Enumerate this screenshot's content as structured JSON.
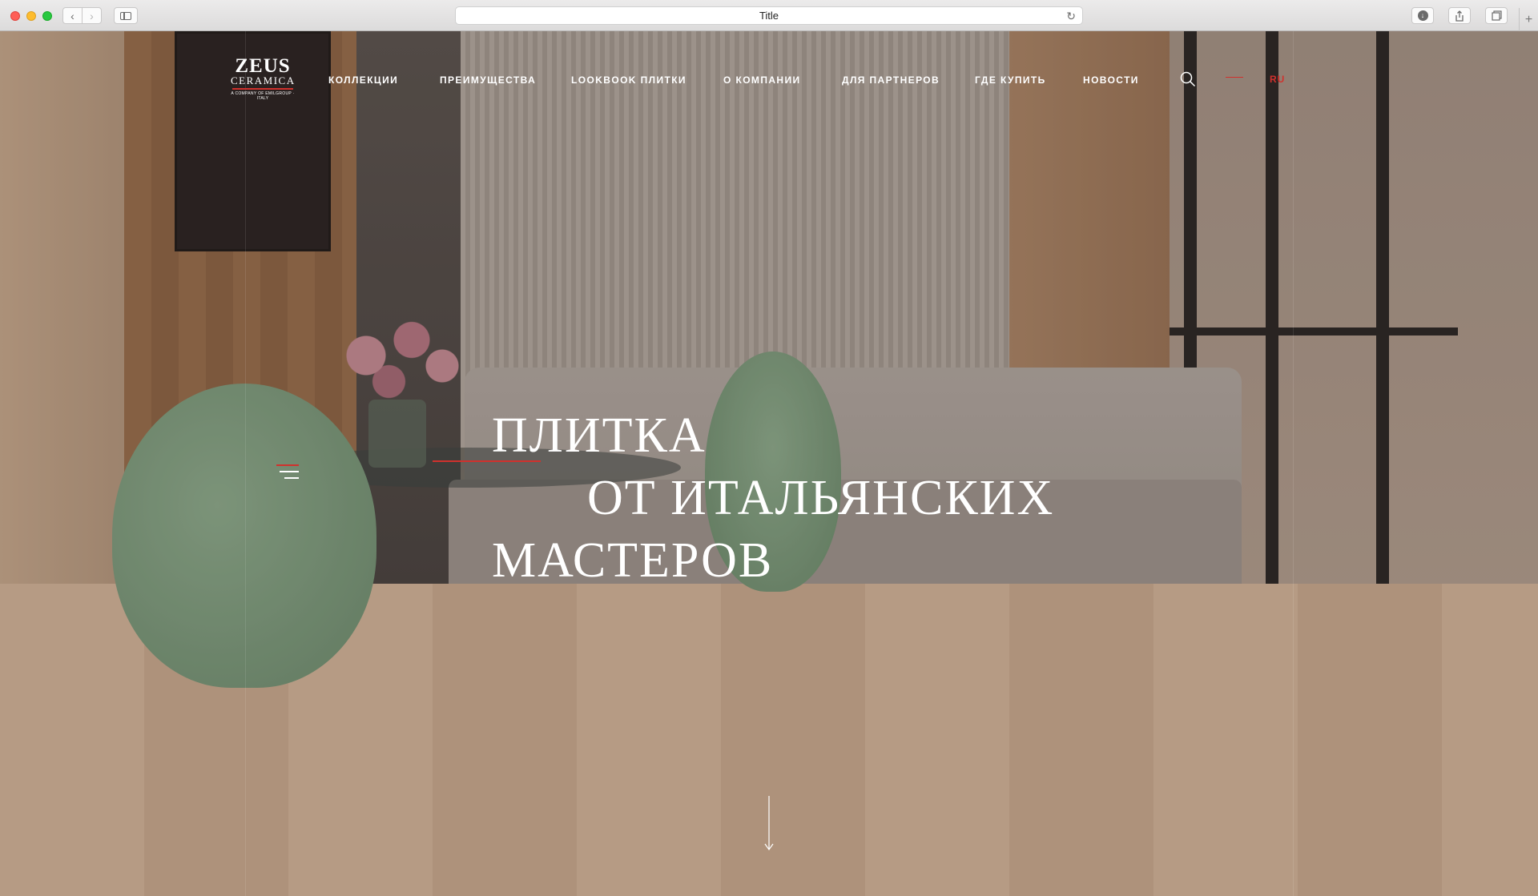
{
  "browser": {
    "tab_title": "Title",
    "back_icon": "chevron-left-icon",
    "forward_icon": "chevron-right-icon",
    "reload_icon": "reload-icon",
    "download_icon": "download-icon",
    "share_icon": "share-icon",
    "tabs_icon": "tabs-overview-icon",
    "new_tab_label": "+"
  },
  "logo": {
    "main": "ZEUS",
    "sub": "CERAMICA",
    "tagline": "A COMPANY OF EMILGROUP · ITALY",
    "accent_color": "#d0312d"
  },
  "nav": {
    "items": [
      {
        "label": "КОЛЛЕКЦИИ"
      },
      {
        "label": "ПРЕИМУЩЕСТВА"
      },
      {
        "label": "LOOKBOOK ПЛИТКИ"
      },
      {
        "label": "О КОМПАНИИ"
      },
      {
        "label": "ДЛЯ ПАРТНЕРОВ"
      },
      {
        "label": "ГДЕ КУПИТЬ"
      },
      {
        "label": "НОВОСТИ"
      }
    ],
    "search_icon": "search-icon",
    "language": "RU"
  },
  "hero": {
    "line1": "ПЛИТКА",
    "line2": "ОТ ИТАЛЬЯНСКИХ",
    "line3": "МАСТЕРОВ",
    "menu_icon": "menu-icon",
    "scroll_icon": "arrow-down-icon"
  },
  "colors": {
    "accent": "#d0312d",
    "text_on_hero": "#ffffff"
  }
}
